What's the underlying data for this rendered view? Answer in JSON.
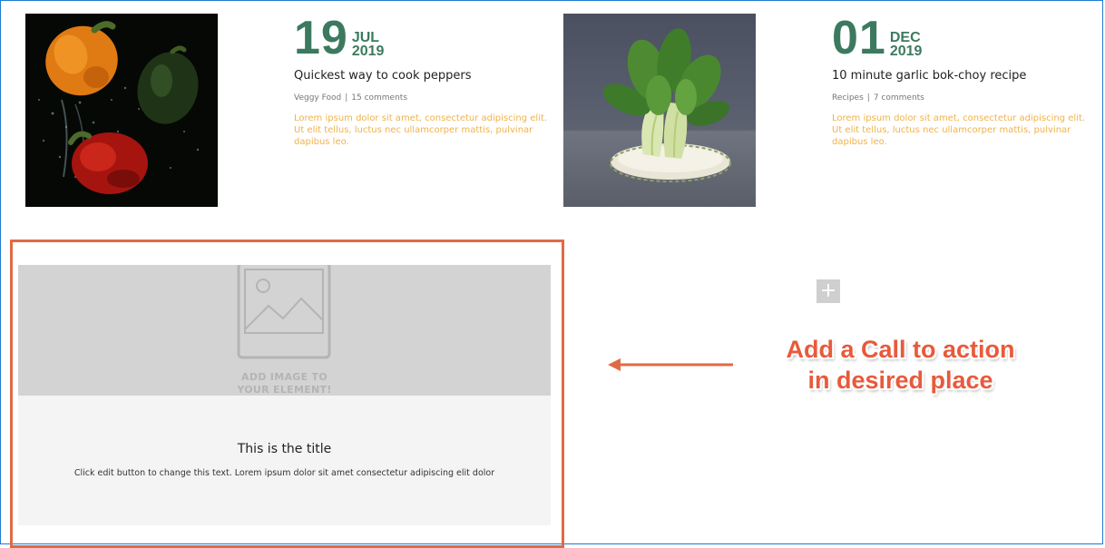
{
  "posts": [
    {
      "day": "19",
      "month": "JUL",
      "year": "2019",
      "title": "Quickest way to cook peppers",
      "category": "Veggy Food",
      "separator": "|",
      "comments": "15 comments",
      "excerpt": "Lorem ipsum dolor sit amet, consectetur adipiscing elit. Ut elit tellus, luctus nec ullamcorper mattis, pulvinar dapibus leo."
    },
    {
      "day": "01",
      "month": "DEC",
      "year": "2019",
      "title": "10 minute garlic bok-choy recipe",
      "category": "Recipes",
      "separator": "|",
      "comments": "7 comments",
      "excerpt": "Lorem ipsum dolor sit amet, consectetur adipiscing elit. Ut elit tellus, luctus nec ullamcorper mattis, pulvinar dapibus leo."
    }
  ],
  "cta": {
    "image_placeholder_line1": "ADD IMAGE TO",
    "image_placeholder_line2": "YOUR ELEMENT!",
    "title": "This is the title",
    "text": "Click edit button to change this text. Lorem ipsum dolor sit amet consectetur adipiscing elit dolor"
  },
  "add_button": {
    "label": "+"
  },
  "annotation": {
    "line1": "Add a Call to action",
    "line2": "in desired place"
  },
  "colors": {
    "date_green": "#3c7a5f",
    "excerpt_orange": "#f0b24a",
    "highlight_orange": "#e06a45",
    "frame_blue": "#1f7bd0",
    "annotation_red": "#e85a3c"
  }
}
